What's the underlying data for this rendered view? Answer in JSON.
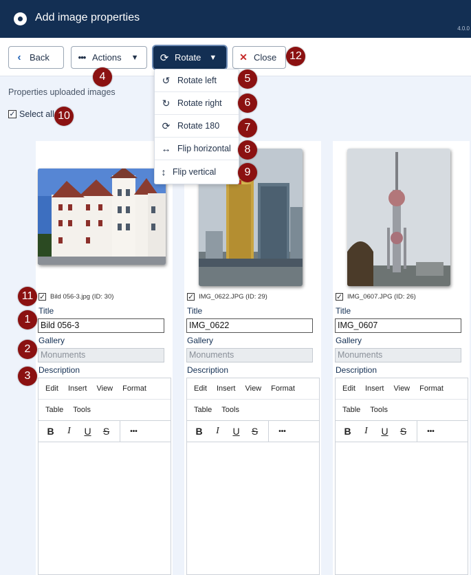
{
  "header": {
    "title": "Add image properties",
    "version": "4.0.0"
  },
  "toolbar": {
    "back_label": "Back",
    "actions_label": "Actions",
    "rotate_label": "Rotate",
    "close_label": "Close"
  },
  "rotate_menu": {
    "items": [
      "Rotate left",
      "Rotate right",
      "Rotate 180",
      "Flip horizontal",
      "Flip vertical"
    ]
  },
  "section": {
    "label": "Properties uploaded images",
    "select_all": "Select all"
  },
  "field_labels": {
    "title": "Title",
    "gallery": "Gallery",
    "description": "Description"
  },
  "editor": {
    "menu": [
      "Edit",
      "Insert",
      "View",
      "Format"
    ],
    "menu2": [
      "Table",
      "Tools"
    ],
    "format_buttons": [
      "B",
      "I",
      "U",
      "S",
      "•••"
    ]
  },
  "images": [
    {
      "filename": "Bild 056-3.jpg (ID: 30)",
      "title": "Bild 056-3",
      "gallery": "Monuments"
    },
    {
      "filename": "IMG_0622.JPG (ID: 29)",
      "title": "IMG_0622",
      "gallery": "Monuments"
    },
    {
      "filename": "IMG_0607.JPG (ID: 26)",
      "title": "IMG_0607",
      "gallery": "Monuments"
    }
  ],
  "callouts": [
    "1",
    "2",
    "3",
    "4",
    "5",
    "6",
    "7",
    "8",
    "9",
    "10",
    "11",
    "12"
  ],
  "colors": {
    "header_bg": "#132f53",
    "callout": "#8b1111",
    "accent_blue": "#2a69b8",
    "close_red": "#c52827"
  }
}
